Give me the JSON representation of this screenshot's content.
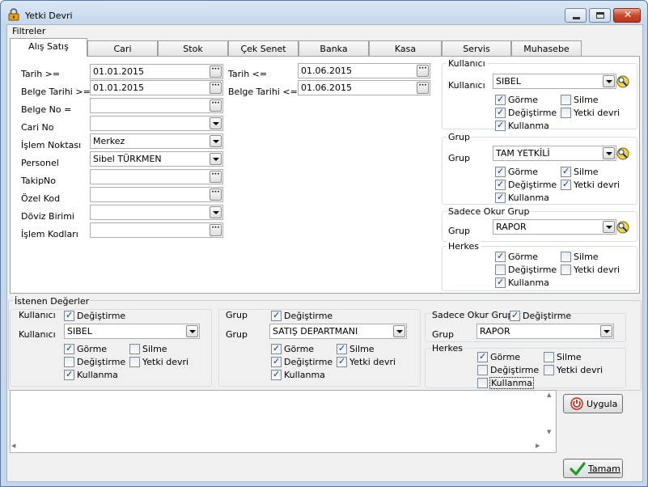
{
  "window": {
    "title": "Yetki Devri"
  },
  "filters": {
    "legend": "Filtreler",
    "tabs": [
      "Alış Satış",
      "Cari",
      "Stok",
      "Çek Senet",
      "Banka",
      "Kasa",
      "Servis",
      "Muhasebe"
    ],
    "left": {
      "tarih_from": {
        "label": "Tarih >=",
        "value": "01.01.2015"
      },
      "belge_tarihi_from": {
        "label": "Belge Tarihi >=",
        "value": "01.01.2015"
      },
      "belge_no": {
        "label": "Belge No =",
        "value": ""
      },
      "cari_no": {
        "label": "Cari No",
        "value": ""
      },
      "islem_noktasi": {
        "label": "İşlem Noktası",
        "value": "Merkez"
      },
      "personel": {
        "label": "Personel",
        "value": "Sibel TÜRKMEN"
      },
      "takip_no": {
        "label": "TakipNo",
        "value": ""
      },
      "ozel_kod": {
        "label": "Özel Kod",
        "value": ""
      },
      "doviz_birimi": {
        "label": "Döviz Birimi",
        "value": ""
      },
      "islem_kodlari": {
        "label": "İşlem Kodları",
        "value": ""
      }
    },
    "middle": {
      "tarih_to": {
        "label": "Tarih <=",
        "value": "01.06.2015"
      },
      "belge_tarihi_to": {
        "label": "Belge Tarihi <=",
        "value": "01.06.2015"
      }
    },
    "kullanici": {
      "legend": "Kullanıcı",
      "label": "Kullanıcı",
      "value": "SIBEL",
      "gorme": {
        "label": "Görme",
        "checked": true
      },
      "silme": {
        "label": "Silme",
        "checked": false
      },
      "degistirme": {
        "label": "Değiştirme",
        "checked": true
      },
      "yetki_devri": {
        "label": "Yetki devri",
        "checked": false
      },
      "kullanma": {
        "label": "Kullanma",
        "checked": true
      }
    },
    "grup": {
      "legend": "Grup",
      "label": "Grup",
      "value": "TAM YETKİLİ",
      "gorme": {
        "label": "Görme",
        "checked": true
      },
      "silme": {
        "label": "Silme",
        "checked": true
      },
      "degistirme": {
        "label": "Değiştirme",
        "checked": true
      },
      "yetki_devri": {
        "label": "Yetki devri",
        "checked": true
      },
      "kullanma": {
        "label": "Kullanma",
        "checked": true
      }
    },
    "sadece_okur": {
      "legend": "Sadece Okur Grup",
      "label": "Grup",
      "value": "RAPOR"
    },
    "herkes": {
      "legend": "Herkes",
      "gorme": {
        "label": "Görme",
        "checked": true
      },
      "silme": {
        "label": "Silme",
        "checked": false
      },
      "degistirme": {
        "label": "Değiştirme",
        "checked": false
      },
      "yetki_devri": {
        "label": "Yetki devri",
        "checked": false
      },
      "kullanma": {
        "label": "Kullanma",
        "checked": true
      }
    }
  },
  "istenen": {
    "legend": "İstenen Değerler",
    "kullanici": {
      "legend": "Kullanıcı",
      "change_label": "Değiştirme",
      "change_checked": true,
      "label": "Kullanıcı",
      "value": "SIBEL",
      "gorme": {
        "label": "Görme",
        "checked": true
      },
      "silme": {
        "label": "Silme",
        "checked": false
      },
      "degistirme": {
        "label": "Değiştirme",
        "checked": false
      },
      "yetki_devri": {
        "label": "Yetki devri",
        "checked": false
      },
      "kullanma": {
        "label": "Kullanma",
        "checked": true
      }
    },
    "grup": {
      "legend": "Grup",
      "change_label": "Değiştirme",
      "change_checked": true,
      "label": "Grup",
      "value": "SATIŞ DEPARTMANI",
      "gorme": {
        "label": "Görme",
        "checked": true
      },
      "silme": {
        "label": "Silme",
        "checked": true
      },
      "degistirme": {
        "label": "Değiştirme",
        "checked": true
      },
      "yetki_devri": {
        "label": "Yetki devri",
        "checked": true
      },
      "kullanma": {
        "label": "Kullanma",
        "checked": true
      }
    },
    "sadece_okur": {
      "legend": "Sadece Okur Grup",
      "change_label": "Değiştirme",
      "change_checked": true,
      "label": "Grup",
      "value": "RAPOR"
    },
    "herkes": {
      "legend": "Herkes",
      "gorme": {
        "label": "Görme",
        "checked": true
      },
      "silme": {
        "label": "Silme",
        "checked": false
      },
      "degistirme": {
        "label": "Değiştirme",
        "checked": false
      },
      "yetki_devri": {
        "label": "Yetki devri",
        "checked": false
      },
      "kullanma": {
        "label": "Kullanma",
        "checked": false
      }
    }
  },
  "buttons": {
    "apply": "Uygula",
    "ok": "Tamam"
  },
  "icons": {
    "title": "lock-icon",
    "apply": "power-icon",
    "ok": "checkmark-icon",
    "group_lookup": "group-lookup-icon"
  },
  "colors": {
    "accent": "#1f3a78",
    "ok_green": "#1c9a2a",
    "apply_red": "#c0281e"
  }
}
